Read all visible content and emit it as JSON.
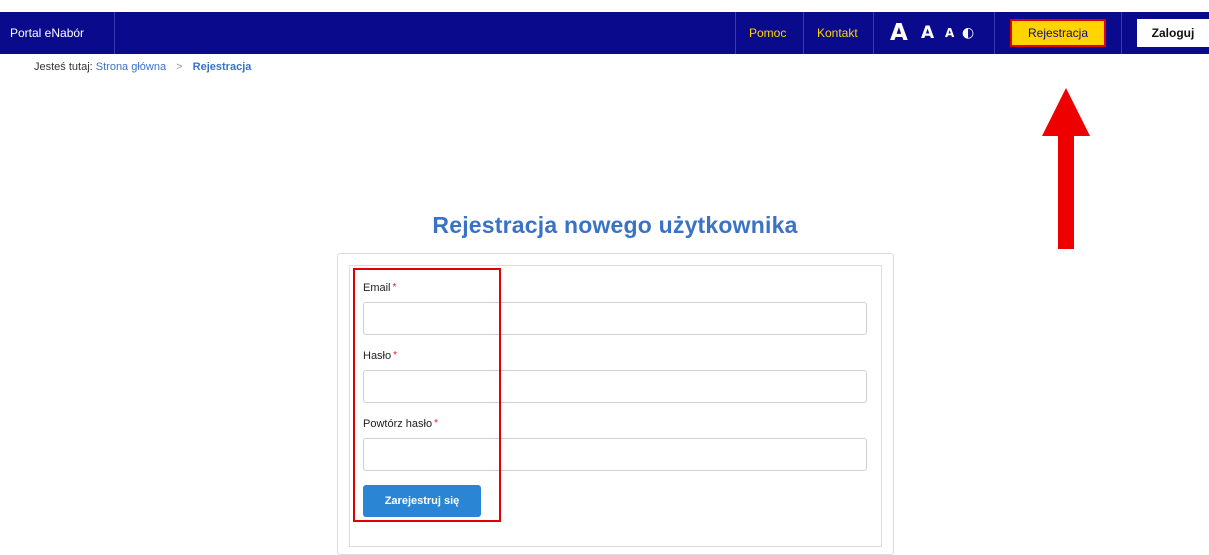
{
  "header": {
    "brand": "Portal eNabór",
    "links": {
      "help": "Pomoc",
      "contact": "Kontakt"
    },
    "font_sizes": {
      "large": "A",
      "medium": "A",
      "small": "A",
      "contrast": "◐"
    },
    "register_label": "Rejestracja",
    "login_label": "Zaloguj"
  },
  "breadcrumb": {
    "prefix": "Jesteś tutaj:",
    "home": "Strona główna",
    "separator": ">",
    "current": "Rejestracja"
  },
  "page": {
    "title": "Rejestracja nowego użytkownika"
  },
  "form": {
    "email_label": "Email",
    "email_value": "",
    "password_label": "Hasło",
    "password_value": "",
    "repeat_label": "Powtórz hasło",
    "repeat_value": "",
    "required_mark": "*",
    "submit_label": "Zarejestruj się"
  },
  "colors": {
    "topbar": "#0a0a8c",
    "nav_link": "#ffd400",
    "accent_blue": "#3a73c4",
    "button_blue": "#2a86d4",
    "annotation_red": "#e00000"
  }
}
